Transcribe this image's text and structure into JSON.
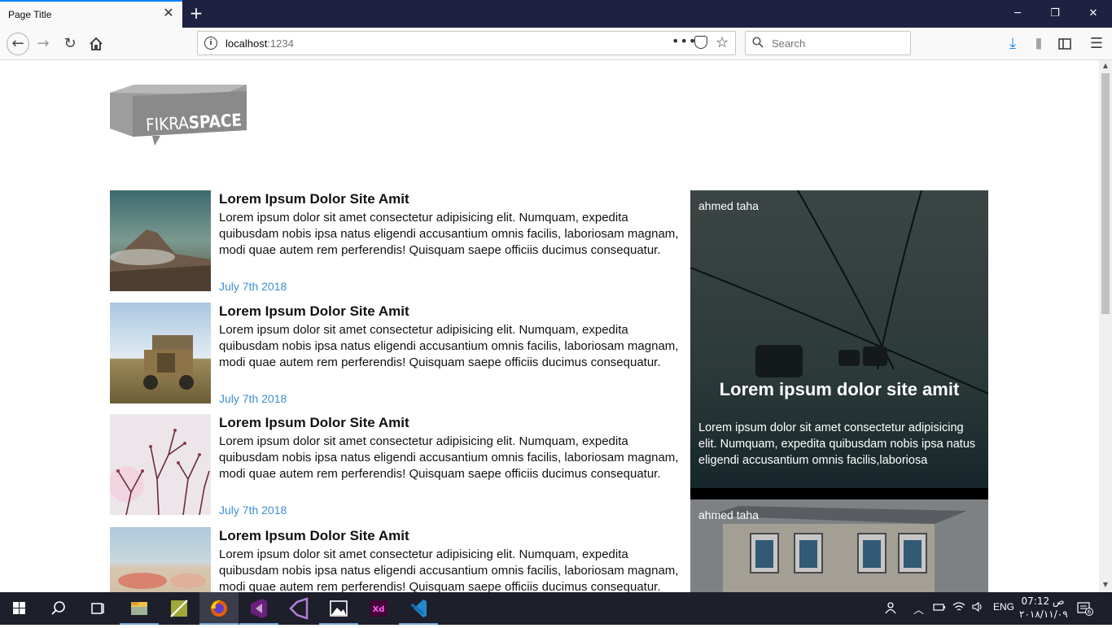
{
  "browser": {
    "tab_title": "Page Title",
    "url_host": "localhost",
    "url_port": ":1234",
    "search_placeholder": "Search"
  },
  "brand": {
    "logo_text_left": "FIKRA",
    "logo_text_right": "SPACE"
  },
  "posts": [
    {
      "title": "Lorem Ipsum Dolor Site Amit",
      "body": "Lorem ipsum dolor sit amet consectetur adipisicing elit. Numquam, expedita quibusdam nobis ipsa natus eligendi accusantium omnis facilis, laboriosam magnam, modi quae autem rem perferendis! Quisquam saepe officiis ducimus consequatur.",
      "date": "July 7th 2018"
    },
    {
      "title": "Lorem Ipsum Dolor Site Amit",
      "body": "Lorem ipsum dolor sit amet consectetur adipisicing elit. Numquam, expedita quibusdam nobis ipsa natus eligendi accusantium omnis facilis, laboriosam magnam, modi quae autem rem perferendis! Quisquam saepe officiis ducimus consequatur.",
      "date": "July 7th 2018"
    },
    {
      "title": "Lorem Ipsum Dolor Site Amit",
      "body": "Lorem ipsum dolor sit amet consectetur adipisicing elit. Numquam, expedita quibusdam nobis ipsa natus eligendi accusantium omnis facilis, laboriosam magnam, modi quae autem rem perferendis! Quisquam saepe officiis ducimus consequatur.",
      "date": "July 7th 2018"
    },
    {
      "title": "Lorem Ipsum Dolor Site Amit",
      "body": "Lorem ipsum dolor sit amet consectetur adipisicing elit. Numquam, expedita quibusdam nobis ipsa natus eligendi accusantium omnis facilis, laboriosam magnam, modi quae autem rem perferendis! Quisquam saepe officiis ducimus consequatur."
    }
  ],
  "cards": [
    {
      "author": "ahmed taha",
      "title": "Lorem ipsum dolor site amit",
      "body": "Lorem ipsum dolor sit amet consectetur adipisicing elit. Numquam, expedita quibusdam nobis ipsa natus eligendi accusantium omnis facilis,laboriosa"
    },
    {
      "author": "ahmed taha"
    }
  ],
  "taskbar": {
    "lang": "ENG",
    "time": "07:12 ص",
    "date": "٢٠١٨/١١/٠٩",
    "notification_count": "6"
  },
  "colors": {
    "date_link": "#3d8fd6",
    "accent": "#0a84ff",
    "taskbar": "#1d1f2b"
  }
}
